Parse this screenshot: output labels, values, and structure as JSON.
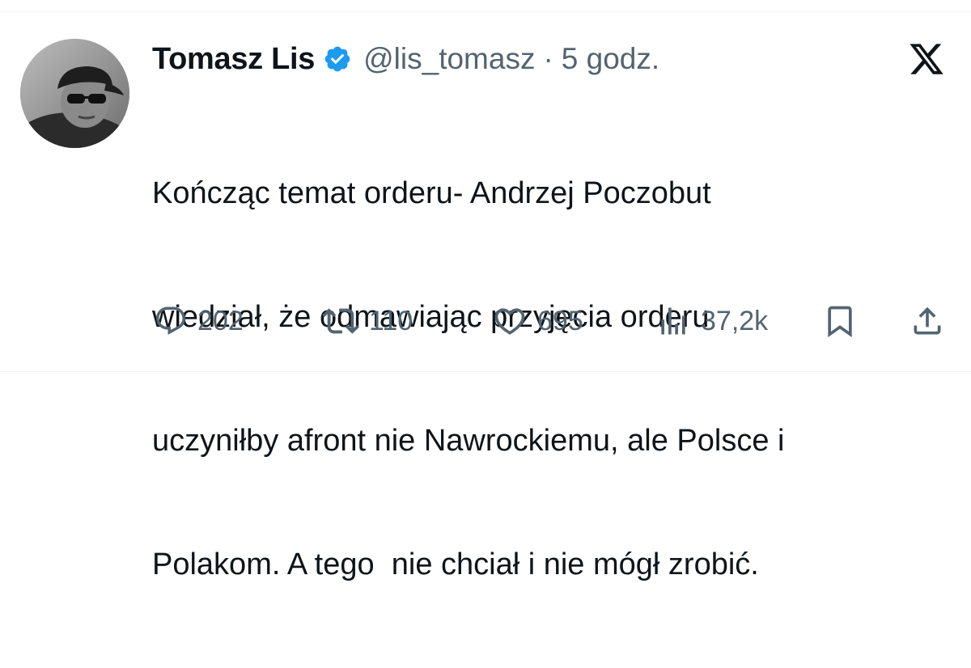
{
  "tweet": {
    "author": {
      "display_name": "Tomasz Lis",
      "handle": "@lis_tomasz",
      "verified": true
    },
    "separator": "·",
    "timestamp": "5 godz.",
    "text_lines": [
      "Kończąc temat orderu- Andrzej Poczobut",
      "wiedział, że odmawiając przyjęcia orderu",
      "uczyniłby afront nie Nawrockiemu, ale Polsce i",
      "Polakom. A tego  nie chciał i nie mógł zrobić."
    ],
    "actions": {
      "replies": "202",
      "reposts": "110",
      "likes": "695",
      "views": "37,2k"
    }
  },
  "icons": {
    "verified": "verified-badge-icon",
    "platform": "x-logo-icon",
    "reply": "reply-icon",
    "repost": "repost-icon",
    "like": "heart-icon",
    "views": "views-icon",
    "bookmark": "bookmark-icon",
    "share": "share-icon"
  },
  "colors": {
    "text_primary": "#0f1419",
    "text_secondary": "#536471",
    "verified_blue": "#1d9bf0",
    "divider": "#eff3f4"
  }
}
